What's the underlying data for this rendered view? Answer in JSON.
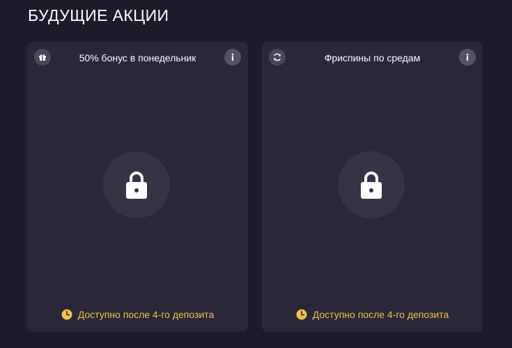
{
  "section": {
    "title": "БУДУЩИЕ АКЦИИ"
  },
  "colors": {
    "background": "#1d1b2a",
    "card": "#292738",
    "accent": "#f2c14e"
  },
  "promotions": [
    {
      "title": "50% бонус в понедельник",
      "badge_icon": "gift-icon",
      "info_icon": "info-icon",
      "status_icon": "lock-icon",
      "footer_icon": "clock-icon",
      "footer_text": "Доступно после 4-го депозита"
    },
    {
      "title": "Фриспины по средам",
      "badge_icon": "refresh-icon",
      "info_icon": "info-icon",
      "status_icon": "lock-icon",
      "footer_icon": "clock-icon",
      "footer_text": "Доступно после 4-го депозита"
    }
  ]
}
